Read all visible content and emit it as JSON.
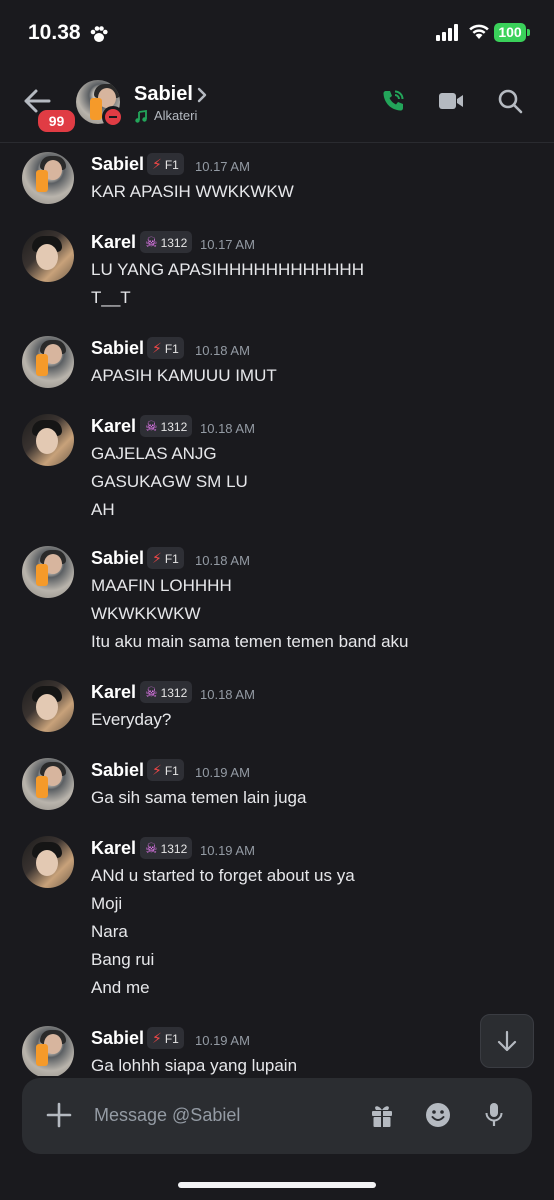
{
  "status_bar": {
    "time": "10.38",
    "battery": "100"
  },
  "header": {
    "unread_badge": "99",
    "name": "Sabiel",
    "status_activity": "Alkateri"
  },
  "messages": [
    {
      "author": "Sabiel",
      "tag": "F1",
      "time": "10.17 AM",
      "lines": [
        "KAR APASIH WWKKWKW"
      ]
    },
    {
      "author": "Karel",
      "tag": "1312",
      "time": "10.17 AM",
      "lines": [
        "LU YANG APASIHHHHHHHHHHHH",
        "T__T"
      ]
    },
    {
      "author": "Sabiel",
      "tag": "F1",
      "time": "10.18 AM",
      "lines": [
        "APASIH KAMUUU IMUT"
      ]
    },
    {
      "author": "Karel",
      "tag": "1312",
      "time": "10.18 AM",
      "lines": [
        "GAJELAS ANJG",
        "GASUKAGW SM LU",
        "AH"
      ]
    },
    {
      "author": "Sabiel",
      "tag": "F1",
      "time": "10.18 AM",
      "lines": [
        "MAAFIN LOHHHH",
        "WKWKKWKW",
        "Itu aku main sama temen temen band aku"
      ]
    },
    {
      "author": "Karel",
      "tag": "1312",
      "time": "10.18 AM",
      "lines": [
        "Everyday?"
      ]
    },
    {
      "author": "Sabiel",
      "tag": "F1",
      "time": "10.19 AM",
      "lines": [
        "Ga sih sama temen lain juga"
      ]
    },
    {
      "author": "Karel",
      "tag": "1312",
      "time": "10.19 AM",
      "lines": [
        "ANd u started to forget about us ya",
        "Moji",
        "Nara",
        "Bang rui",
        "And me"
      ]
    },
    {
      "author": "Sabiel",
      "tag": "F1",
      "time": "10.19 AM",
      "lines": [
        "Ga lohhh siapa yang lupain"
      ]
    }
  ],
  "composer": {
    "placeholder": "Message @Sabiel"
  },
  "colors": {
    "background": "#1a1a1e",
    "call_green": "#23a55a",
    "badge_red": "#e03c44"
  },
  "icons": [
    "paw-icon",
    "signal-icon",
    "wifi-icon",
    "back-arrow-icon",
    "chevron-right-icon",
    "music-note-icon",
    "phone-call-icon",
    "video-icon",
    "search-icon",
    "lightning-icon",
    "skull-icon",
    "arrow-down-icon",
    "plus-icon",
    "gift-icon",
    "emoji-icon",
    "mic-icon"
  ]
}
